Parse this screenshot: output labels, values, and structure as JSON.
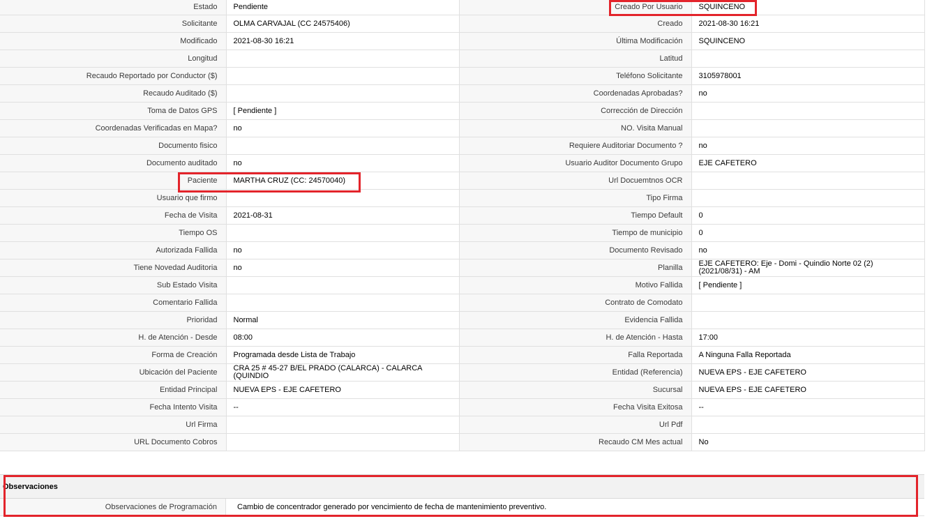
{
  "rows": [
    {
      "l1": "Estado",
      "v1": "Pendiente",
      "l2": "Creado Por Usuario",
      "v2": "SQUINCENO"
    },
    {
      "l1": "Solicitante",
      "v1": "OLMA CARVAJAL (CC 24575406)",
      "l2": "Creado",
      "v2": "2021-08-30 16:21"
    },
    {
      "l1": "Modificado",
      "v1": "2021-08-30 16:21",
      "l2": "Última Modificación",
      "v2": " SQUINCENO"
    },
    {
      "l1": "Longitud",
      "v1": "",
      "l2": "Latitud",
      "v2": ""
    },
    {
      "l1": "Recaudo Reportado por Conductor ($)",
      "v1": "",
      "l2": "Teléfono Solicitante",
      "v2": "3105978001"
    },
    {
      "l1": "Recaudo Auditado ($)",
      "v1": "",
      "l2": "Coordenadas Aprobadas?",
      "v2": " no"
    },
    {
      "l1": "Toma de Datos GPS",
      "v1": "[ Pendiente ]",
      "l2": "Corrección de Dirección",
      "v2": ""
    },
    {
      "l1": "Coordenadas Verificadas en Mapa?",
      "v1": " no",
      "l2": "NO. Visita Manual",
      "v2": ""
    },
    {
      "l1": "Documento fisico",
      "v1": "",
      "l2": "Requiere Auditoriar Documento ?",
      "v2": " no"
    },
    {
      "l1": "Documento auditado",
      "v1": "no",
      "l2": "Usuario Auditor Documento Grupo",
      "v2": "EJE CAFETERO"
    },
    {
      "l1": "Paciente",
      "v1": "MARTHA CRUZ (CC: 24570040)",
      "l2": "Url Docuemtnos OCR",
      "v2": ""
    },
    {
      "l1": "Usuario que firmo",
      "v1": "",
      "l2": "Tipo Firma",
      "v2": ""
    },
    {
      "l1": "Fecha de Visita",
      "v1": " 2021-08-31",
      "l2": "Tiempo Default",
      "v2": "0"
    },
    {
      "l1": "Tiempo OS",
      "v1": "",
      "l2": "Tiempo de municipio",
      "v2": "0"
    },
    {
      "l1": "Autorizada Fallida",
      "v1": "no",
      "l2": "Documento Revisado",
      "v2": " no"
    },
    {
      "l1": "Tiene Novedad Auditoria",
      "v1": "no",
      "l2": "Planilla",
      "v2": "EJE CAFETERO: Eje - Domi - Quindio Norte 02 (2) (2021/08/31) - AM"
    },
    {
      "l1": "Sub Estado Visita",
      "v1": "",
      "l2": "Motivo Fallida",
      "v2": "[ Pendiente ]"
    },
    {
      "l1": "Comentario Fallida",
      "v1": "",
      "l2": "Contrato de Comodato",
      "v2": ""
    },
    {
      "l1": "Prioridad",
      "v1": "Normal",
      "l2": "Evidencia Fallida",
      "v2": ""
    },
    {
      "l1": "H. de Atención - Desde",
      "v1": "08:00",
      "l2": "H. de Atención - Hasta",
      "v2": "17:00"
    },
    {
      "l1": "Forma de Creación",
      "v1": "Programada desde Lista de Trabajo",
      "l2": "Falla Reportada",
      "v2": "A Ninguna Falla Reportada"
    },
    {
      "l1": "Ubicación del Paciente",
      "v1": "CRA 25 # 45-27 B/EL PRADO (CALARCA) - CALARCA (QUINDIO",
      "l2": "Entidad (Referencia)",
      "v2": "NUEVA EPS - EJE CAFETERO"
    },
    {
      "l1": "Entidad Principal",
      "v1": "NUEVA EPS - EJE CAFETERO",
      "l2": "Sucursal",
      "v2": "NUEVA EPS - EJE CAFETERO"
    },
    {
      "l1": "Fecha Intento Visita",
      "v1": " --",
      "l2": "Fecha Visita Exitosa",
      "v2": " --"
    },
    {
      "l1": "Url Firma",
      "v1": "",
      "l2": "Url Pdf",
      "v2": ""
    },
    {
      "l1": "URL Documento Cobros",
      "v1": "",
      "l2": "Recaudo CM Mes actual",
      "v2": "No"
    }
  ],
  "observaciones": {
    "title": "Observaciones",
    "label": "Observaciones de Programación",
    "value": "Cambio de concentrador generado por vencimiento de fecha de mantenimiento preventivo."
  },
  "highlight_color": "#e3242b"
}
